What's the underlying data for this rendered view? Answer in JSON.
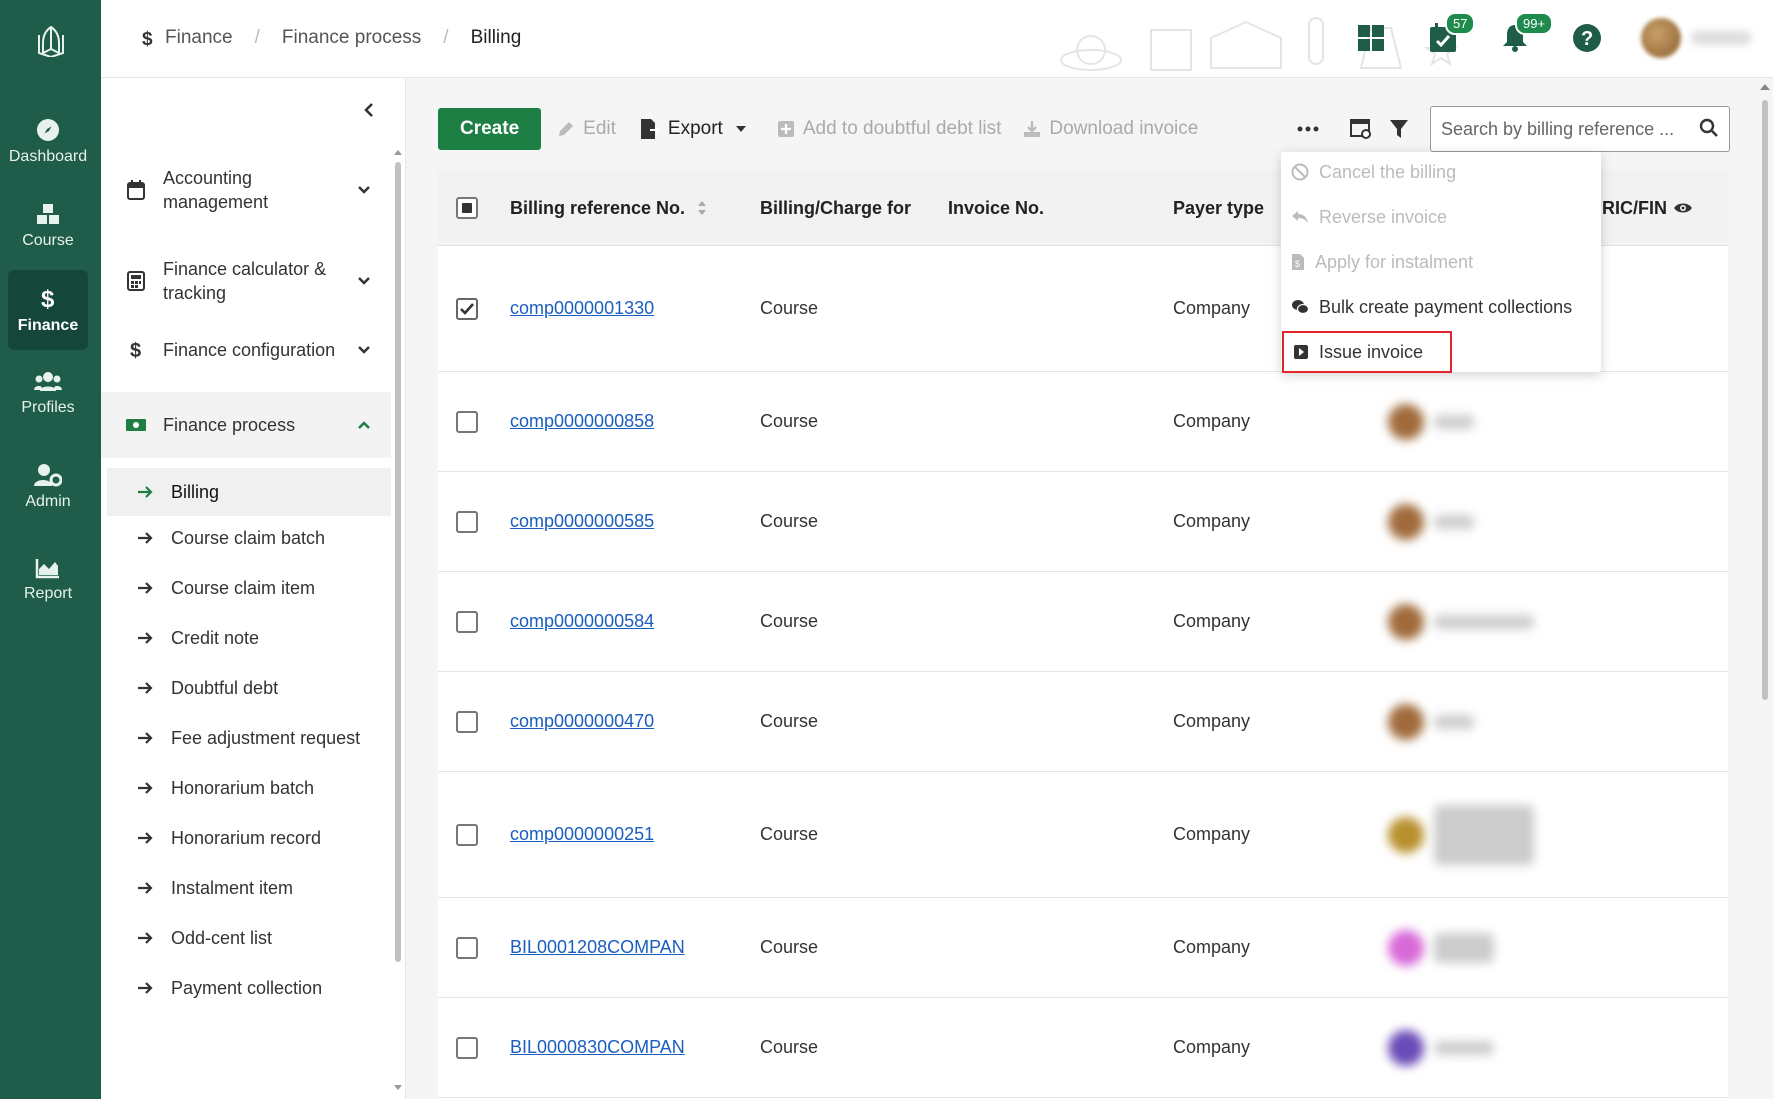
{
  "rail": {
    "items": [
      {
        "label": "Dashboard",
        "icon": "compass-icon"
      },
      {
        "label": "Course",
        "icon": "cubes-icon"
      },
      {
        "label": "Finance",
        "icon": "dollar-icon"
      },
      {
        "label": "Profiles",
        "icon": "users-icon"
      },
      {
        "label": "Admin",
        "icon": "user-gear-icon"
      },
      {
        "label": "Report",
        "icon": "area-chart-icon"
      }
    ]
  },
  "breadcrumb": {
    "items": [
      "Finance",
      "Finance process",
      "Billing"
    ]
  },
  "topbar": {
    "tasks_badge": "57",
    "notifications_badge": "99+"
  },
  "side": {
    "groups": [
      {
        "label": "Accounting management",
        "expanded": false
      },
      {
        "label": "Finance calculator & tracking",
        "expanded": false
      },
      {
        "label": "Finance configuration",
        "expanded": false
      },
      {
        "label": "Finance process",
        "expanded": true
      }
    ],
    "sub_items": [
      "Billing",
      "Course claim batch",
      "Course claim item",
      "Credit note",
      "Doubtful debt",
      "Fee adjustment request",
      "Honorarium batch",
      "Honorarium record",
      "Instalment item",
      "Odd-cent list",
      "Payment collection"
    ],
    "active_sub": "Billing"
  },
  "toolbar": {
    "create": "Create",
    "edit": "Edit",
    "export": "Export",
    "add_doubtful": "Add to doubtful debt list",
    "download_invoice": "Download invoice",
    "search_placeholder": "Search by billing reference ..."
  },
  "table": {
    "headers": {
      "ref": "Billing reference No.",
      "charge_for": "Billing/Charge for",
      "invoice": "Invoice No.",
      "payer_type": "Payer type",
      "nric": "RIC/FIN"
    },
    "rows": [
      {
        "ref": "comp0000001330",
        "charge_for": "Course",
        "invoice": "",
        "payer_type": "Company",
        "checked": true
      },
      {
        "ref": "comp0000000858",
        "charge_for": "Course",
        "invoice": "",
        "payer_type": "Company",
        "checked": false
      },
      {
        "ref": "comp0000000585",
        "charge_for": "Course",
        "invoice": "",
        "payer_type": "Company",
        "checked": false
      },
      {
        "ref": "comp0000000584",
        "charge_for": "Course",
        "invoice": "",
        "payer_type": "Company",
        "checked": false
      },
      {
        "ref": "comp0000000470",
        "charge_for": "Course",
        "invoice": "",
        "payer_type": "Company",
        "checked": false
      },
      {
        "ref": "comp0000000251",
        "charge_for": "Course",
        "invoice": "",
        "payer_type": "Company",
        "checked": false
      },
      {
        "ref": "BIL0001208COMPAN",
        "charge_for": "Course",
        "invoice": "",
        "payer_type": "Company",
        "checked": false
      },
      {
        "ref": "BIL0000830COMPAN",
        "charge_for": "Course",
        "invoice": "",
        "payer_type": "Company",
        "checked": false
      }
    ]
  },
  "dropdown": {
    "items": [
      {
        "label": "Cancel the billing",
        "enabled": false,
        "icon": "ban-icon"
      },
      {
        "label": "Reverse invoice",
        "enabled": false,
        "icon": "reply-icon"
      },
      {
        "label": "Apply for instalment",
        "enabled": false,
        "icon": "file-icon"
      },
      {
        "label": "Bulk create payment collections",
        "enabled": true,
        "icon": "coins-icon"
      },
      {
        "label": "Issue invoice",
        "enabled": true,
        "icon": "play-square-icon",
        "highlighted": true
      }
    ]
  },
  "colors": {
    "rail_bg": "#1f5c4a",
    "primary": "#1e7f45",
    "link": "#1a5ec0",
    "highlight": "#e0262c"
  }
}
